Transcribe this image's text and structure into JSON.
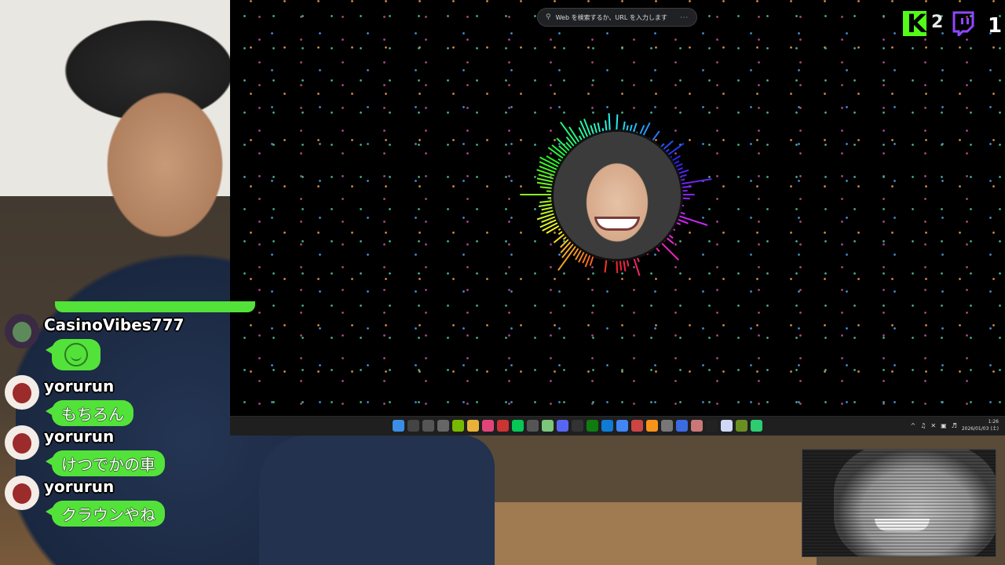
{
  "browser": {
    "address_placeholder": "Web を検索するか、URL を入力します",
    "search_icon": "search-icon",
    "more_icon": "more-icon"
  },
  "platforms": {
    "kick_viewers": "2",
    "twitch_viewers": "1",
    "kick_color": "#53fc18",
    "twitch_color": "#9146ff"
  },
  "chat": {
    "messages": [
      {
        "user": "CasinoVibes777",
        "text": "",
        "type": "emoji",
        "emoji": "smile-emoji"
      },
      {
        "user": "yorurun",
        "text": "もちろん"
      },
      {
        "user": "yorurun",
        "text": "けつでかの車"
      },
      {
        "user": "yorurun",
        "text": "クラウンやね"
      }
    ],
    "bubble_color": "#53e23a"
  },
  "taskbar": {
    "icons": [
      "windows-icon",
      "search-icon",
      "taskview-icon",
      "obs-icon",
      "nvidia-icon",
      "explorer-icon",
      "lips-icon",
      "record-icon",
      "line-icon",
      "chatgpt-icon",
      "sheets-icon",
      "discord-icon",
      "mahjong-icon",
      "xbox-icon",
      "edge-icon",
      "chrome-icon",
      "app-icon",
      "bitcoin-icon",
      "back-icon",
      "mail-icon",
      "photo-icon",
      "dark-icon",
      "notes-icon",
      "minecraft-icon",
      "play-icon"
    ],
    "clock_time": "1:26",
    "clock_date": "2026/01/03 (土)"
  }
}
